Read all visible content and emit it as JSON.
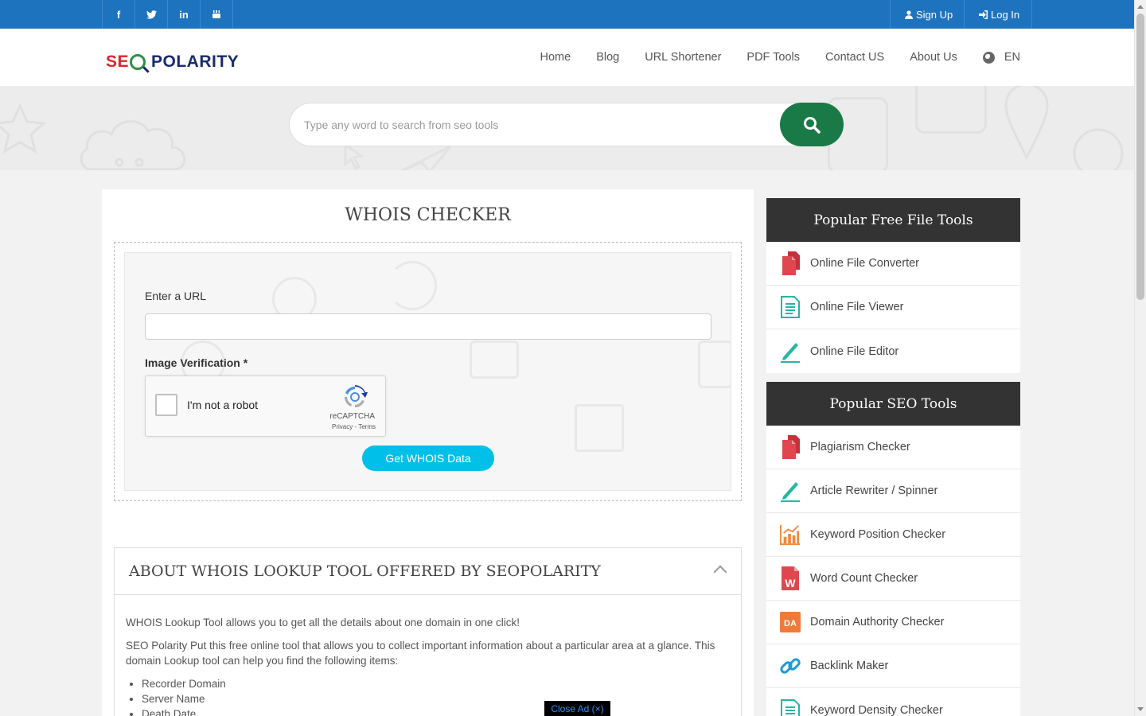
{
  "topbar": {
    "social": [
      {
        "name": "facebook",
        "glyph": "f"
      },
      {
        "name": "twitter",
        "glyph": "t"
      },
      {
        "name": "linkedin",
        "glyph": "in"
      },
      {
        "name": "youtube",
        "glyph": "▶"
      }
    ],
    "signup_label": "Sign Up",
    "login_label": "Log In"
  },
  "header": {
    "logo_se": "SE",
    "logo_rest": "POLARITY",
    "nav": [
      "Home",
      "Blog",
      "URL Shortener",
      "PDF Tools",
      "Contact US",
      "About Us"
    ],
    "language": "EN"
  },
  "search": {
    "placeholder": "Type any word to search from seo tools"
  },
  "tool": {
    "title": "WHOIS CHECKER",
    "url_label": "Enter a URL",
    "url_value": "",
    "verification_label": "Image Verification *",
    "captcha_text": "I'm not a robot",
    "captcha_brand": "reCAPTCHA",
    "captcha_links": "Privacy - Terms",
    "submit_label": "Get WHOIS Data"
  },
  "about": {
    "title": "ABOUT WHOIS LOOKUP TOOL OFFERED BY SEOPOLARITY",
    "p1": "WHOIS Lookup Tool allows you to get all the details about one domain in one click!",
    "p2": "SEO Polarity Put this free online tool that allows you to collect important information about a particular area at a glance. This domain Lookup tool can help you find the following items:",
    "items": [
      "Recorder Domain",
      "Server Name",
      "Death Date"
    ]
  },
  "sidebar": {
    "file_tools_title": "Popular Free File Tools",
    "file_tools": [
      {
        "label": "Online File Converter",
        "icon": "file-icon",
        "color": "#e0464f"
      },
      {
        "label": "Online File Viewer",
        "icon": "document-icon",
        "color": "#26b5a3"
      },
      {
        "label": "Online File Editor",
        "icon": "pencil-icon",
        "color": "#26b5a3"
      }
    ],
    "seo_tools_title": "Popular SEO Tools",
    "seo_tools": [
      {
        "label": "Plagiarism Checker",
        "icon": "file-icon",
        "color": "#e0464f"
      },
      {
        "label": "Article Rewriter / Spinner",
        "icon": "pencil-icon",
        "color": "#26b5a3"
      },
      {
        "label": "Keyword Position Checker",
        "icon": "bar-chart-icon",
        "color": "#f08a3a"
      },
      {
        "label": "Word Count Checker",
        "icon": "word-icon",
        "color": "#e0464f",
        "glyph": "W"
      },
      {
        "label": "Domain Authority Checker",
        "icon": "da-icon",
        "color": "#f07a3a",
        "glyph": "DA"
      },
      {
        "label": "Backlink Maker",
        "icon": "link-icon",
        "color": "#1b9bd7"
      },
      {
        "label": "Keyword Density Checker",
        "icon": "document-icon",
        "color": "#26b5a3"
      }
    ]
  },
  "ad": {
    "close_label": "Close Ad (×)"
  },
  "colors": {
    "topbar": "#1e73be",
    "search_button": "#1a7a47",
    "submit_button": "#00bfe8",
    "sidebar_header": "#333333"
  }
}
